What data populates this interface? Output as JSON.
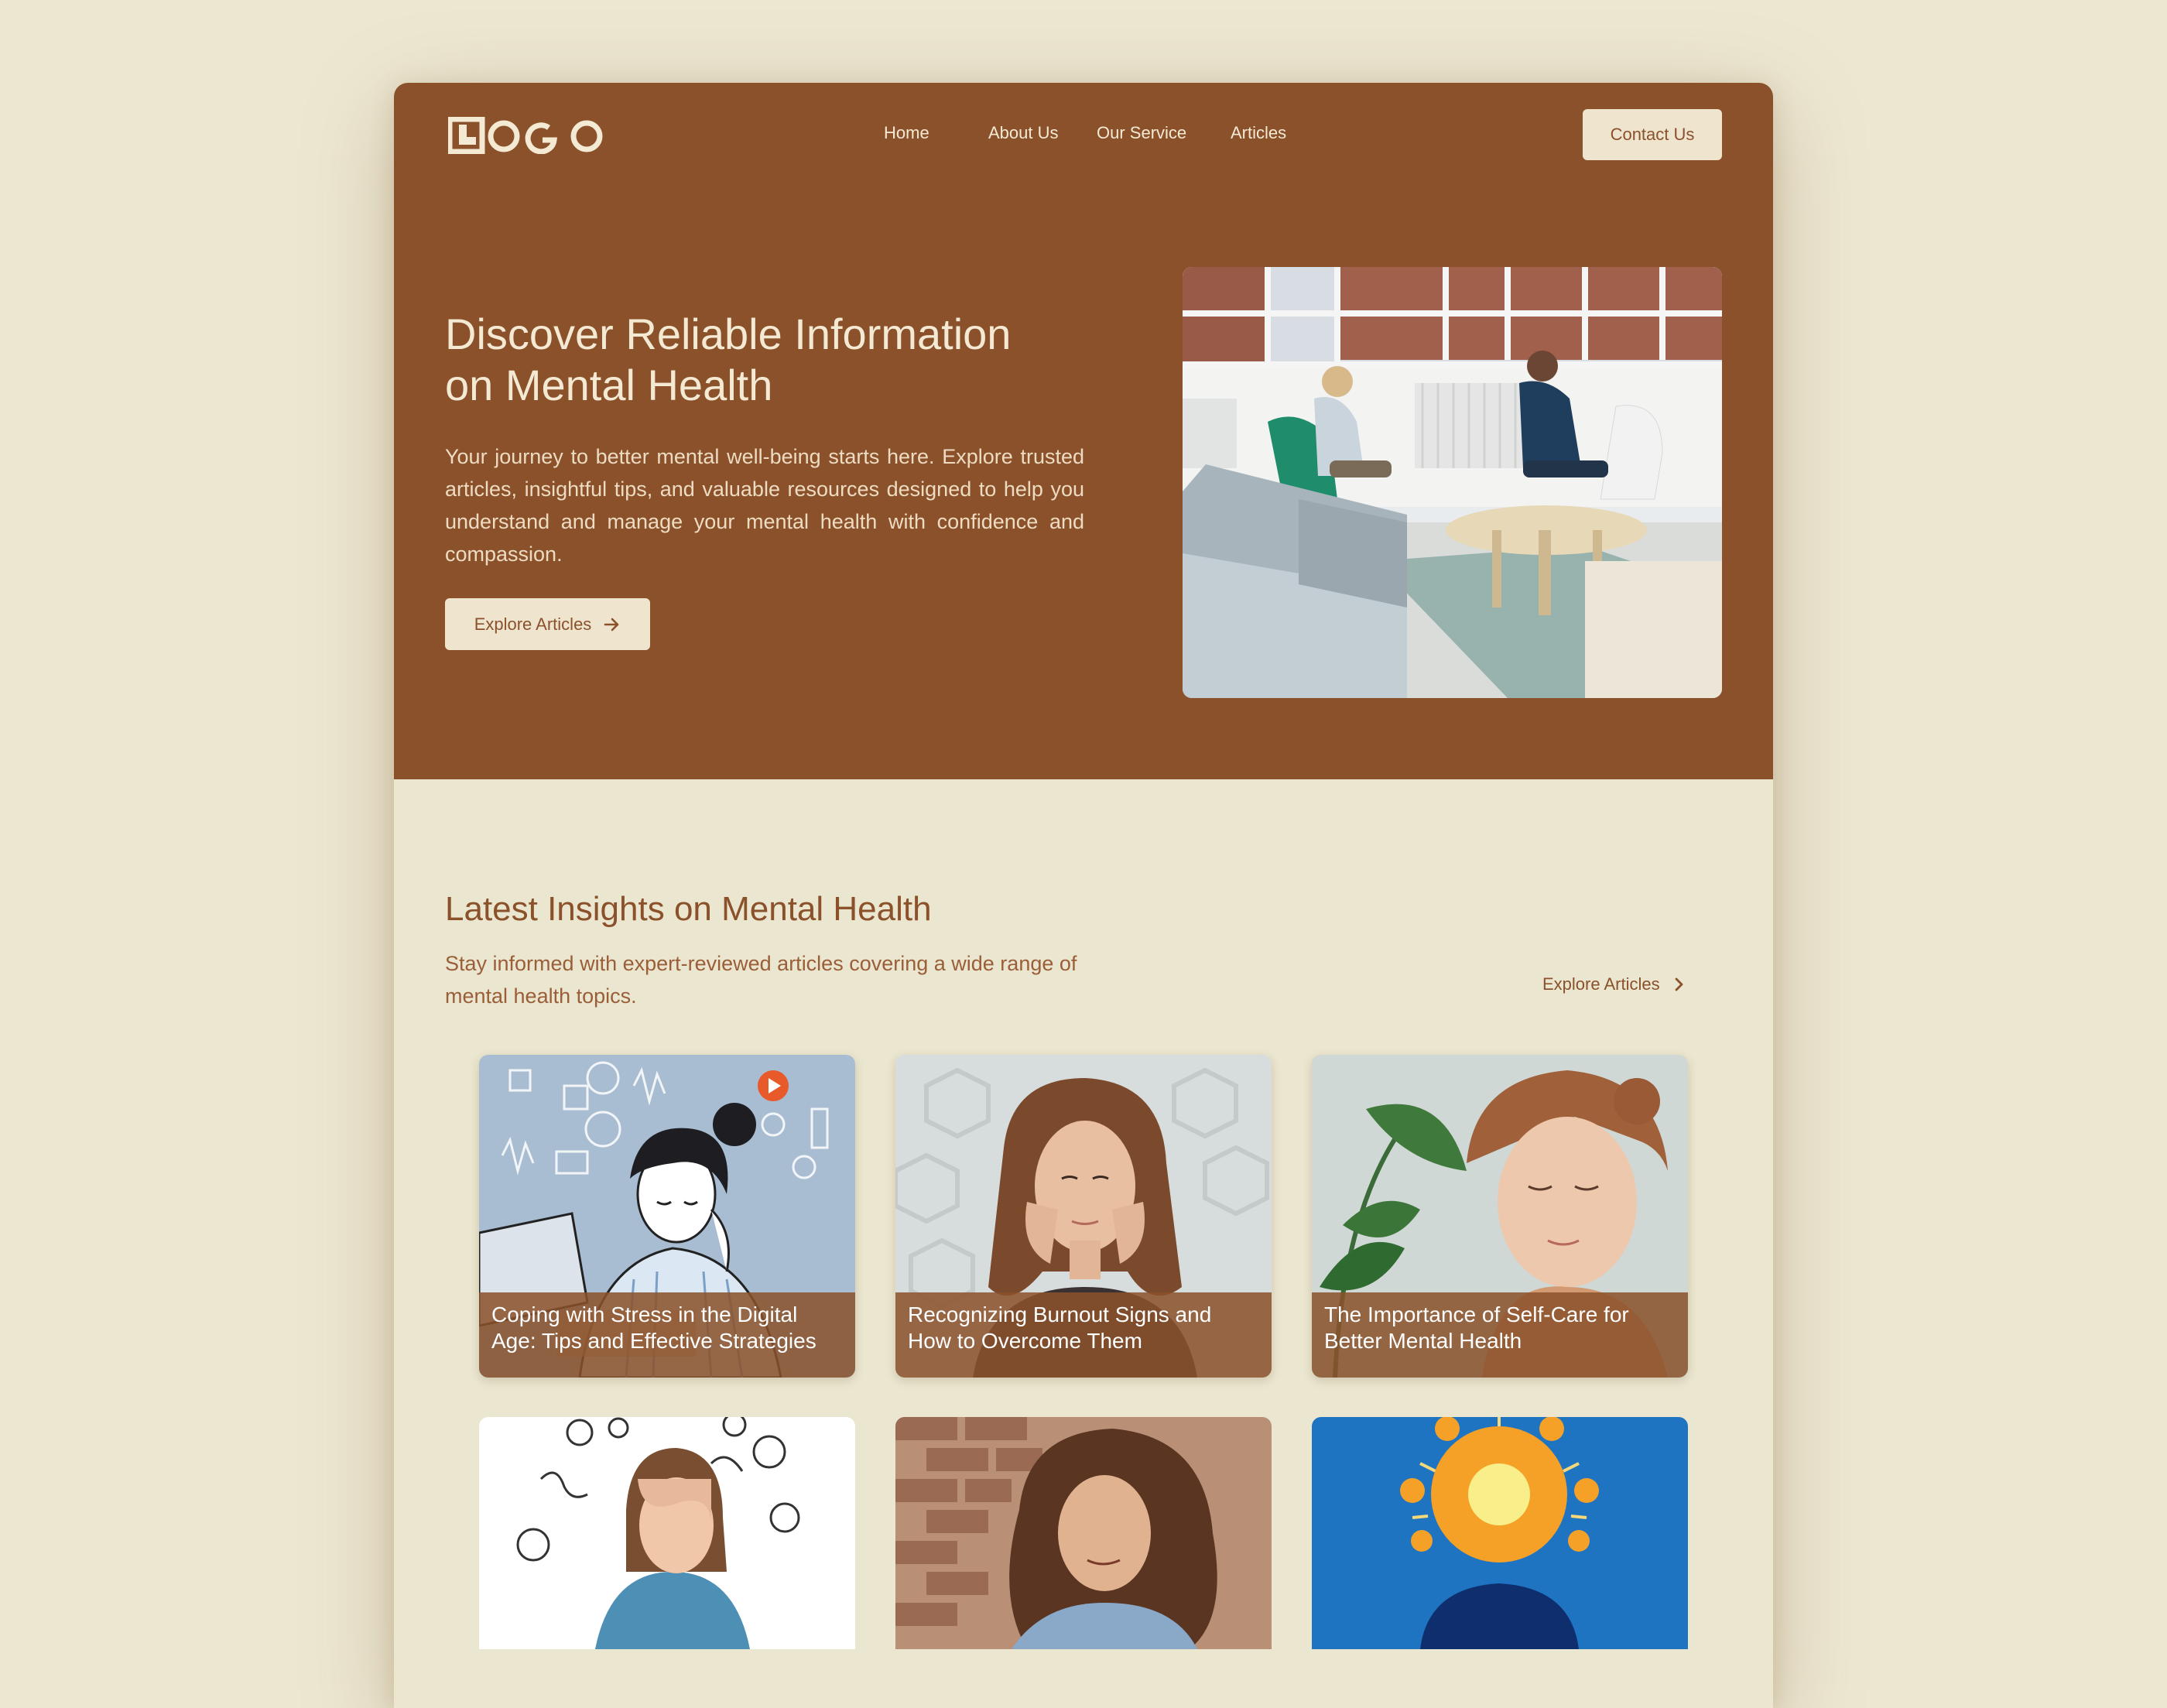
{
  "header": {
    "logo_text": "LOGO",
    "nav": [
      "Home",
      "About Us",
      "Our Service",
      "Articles"
    ],
    "contact_label": "Contact Us"
  },
  "hero": {
    "title": "Discover Reliable Information on Mental Health",
    "text": "Your journey to better mental well-being starts here. Explore trusted articles, insightful tips, and valuable resources designed to help you understand and manage your mental health with confidence and compassion.",
    "button_label": "Explore Articles"
  },
  "insights": {
    "title": "Latest Insights on Mental Health",
    "subtitle": "Stay informed with expert-reviewed articles covering a wide range of mental health topics.",
    "link_label": "Explore Articles",
    "articles": [
      {
        "title": "Coping with Stress in the Digital Age: Tips and Effective Strategies"
      },
      {
        "title": "Recognizing Burnout Signs and How to Overcome Them"
      },
      {
        "title": "The Importance of Self-Care for Better Mental Health"
      }
    ]
  },
  "colors": {
    "brand_brown": "#8a512b",
    "cream": "#efe5cf",
    "page_bg": "#ede7d2"
  }
}
